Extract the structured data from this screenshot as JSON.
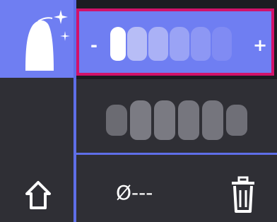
{
  "colors": {
    "accent": "#6f7ef2",
    "panel_dark": "#2f2f35",
    "highlight_border": "#d2126a"
  },
  "left_rail": {
    "add_icon": "tooth-with-sparkles-icon",
    "home_icon": "home-icon"
  },
  "shade_selector": {
    "decrement_label": "-",
    "increment_label": "+",
    "selected_index": 0,
    "count": 6
  },
  "shade_preview": {
    "count": 6
  },
  "bottom_bar": {
    "empty_label": "Ø---",
    "delete_icon": "trash-icon"
  }
}
